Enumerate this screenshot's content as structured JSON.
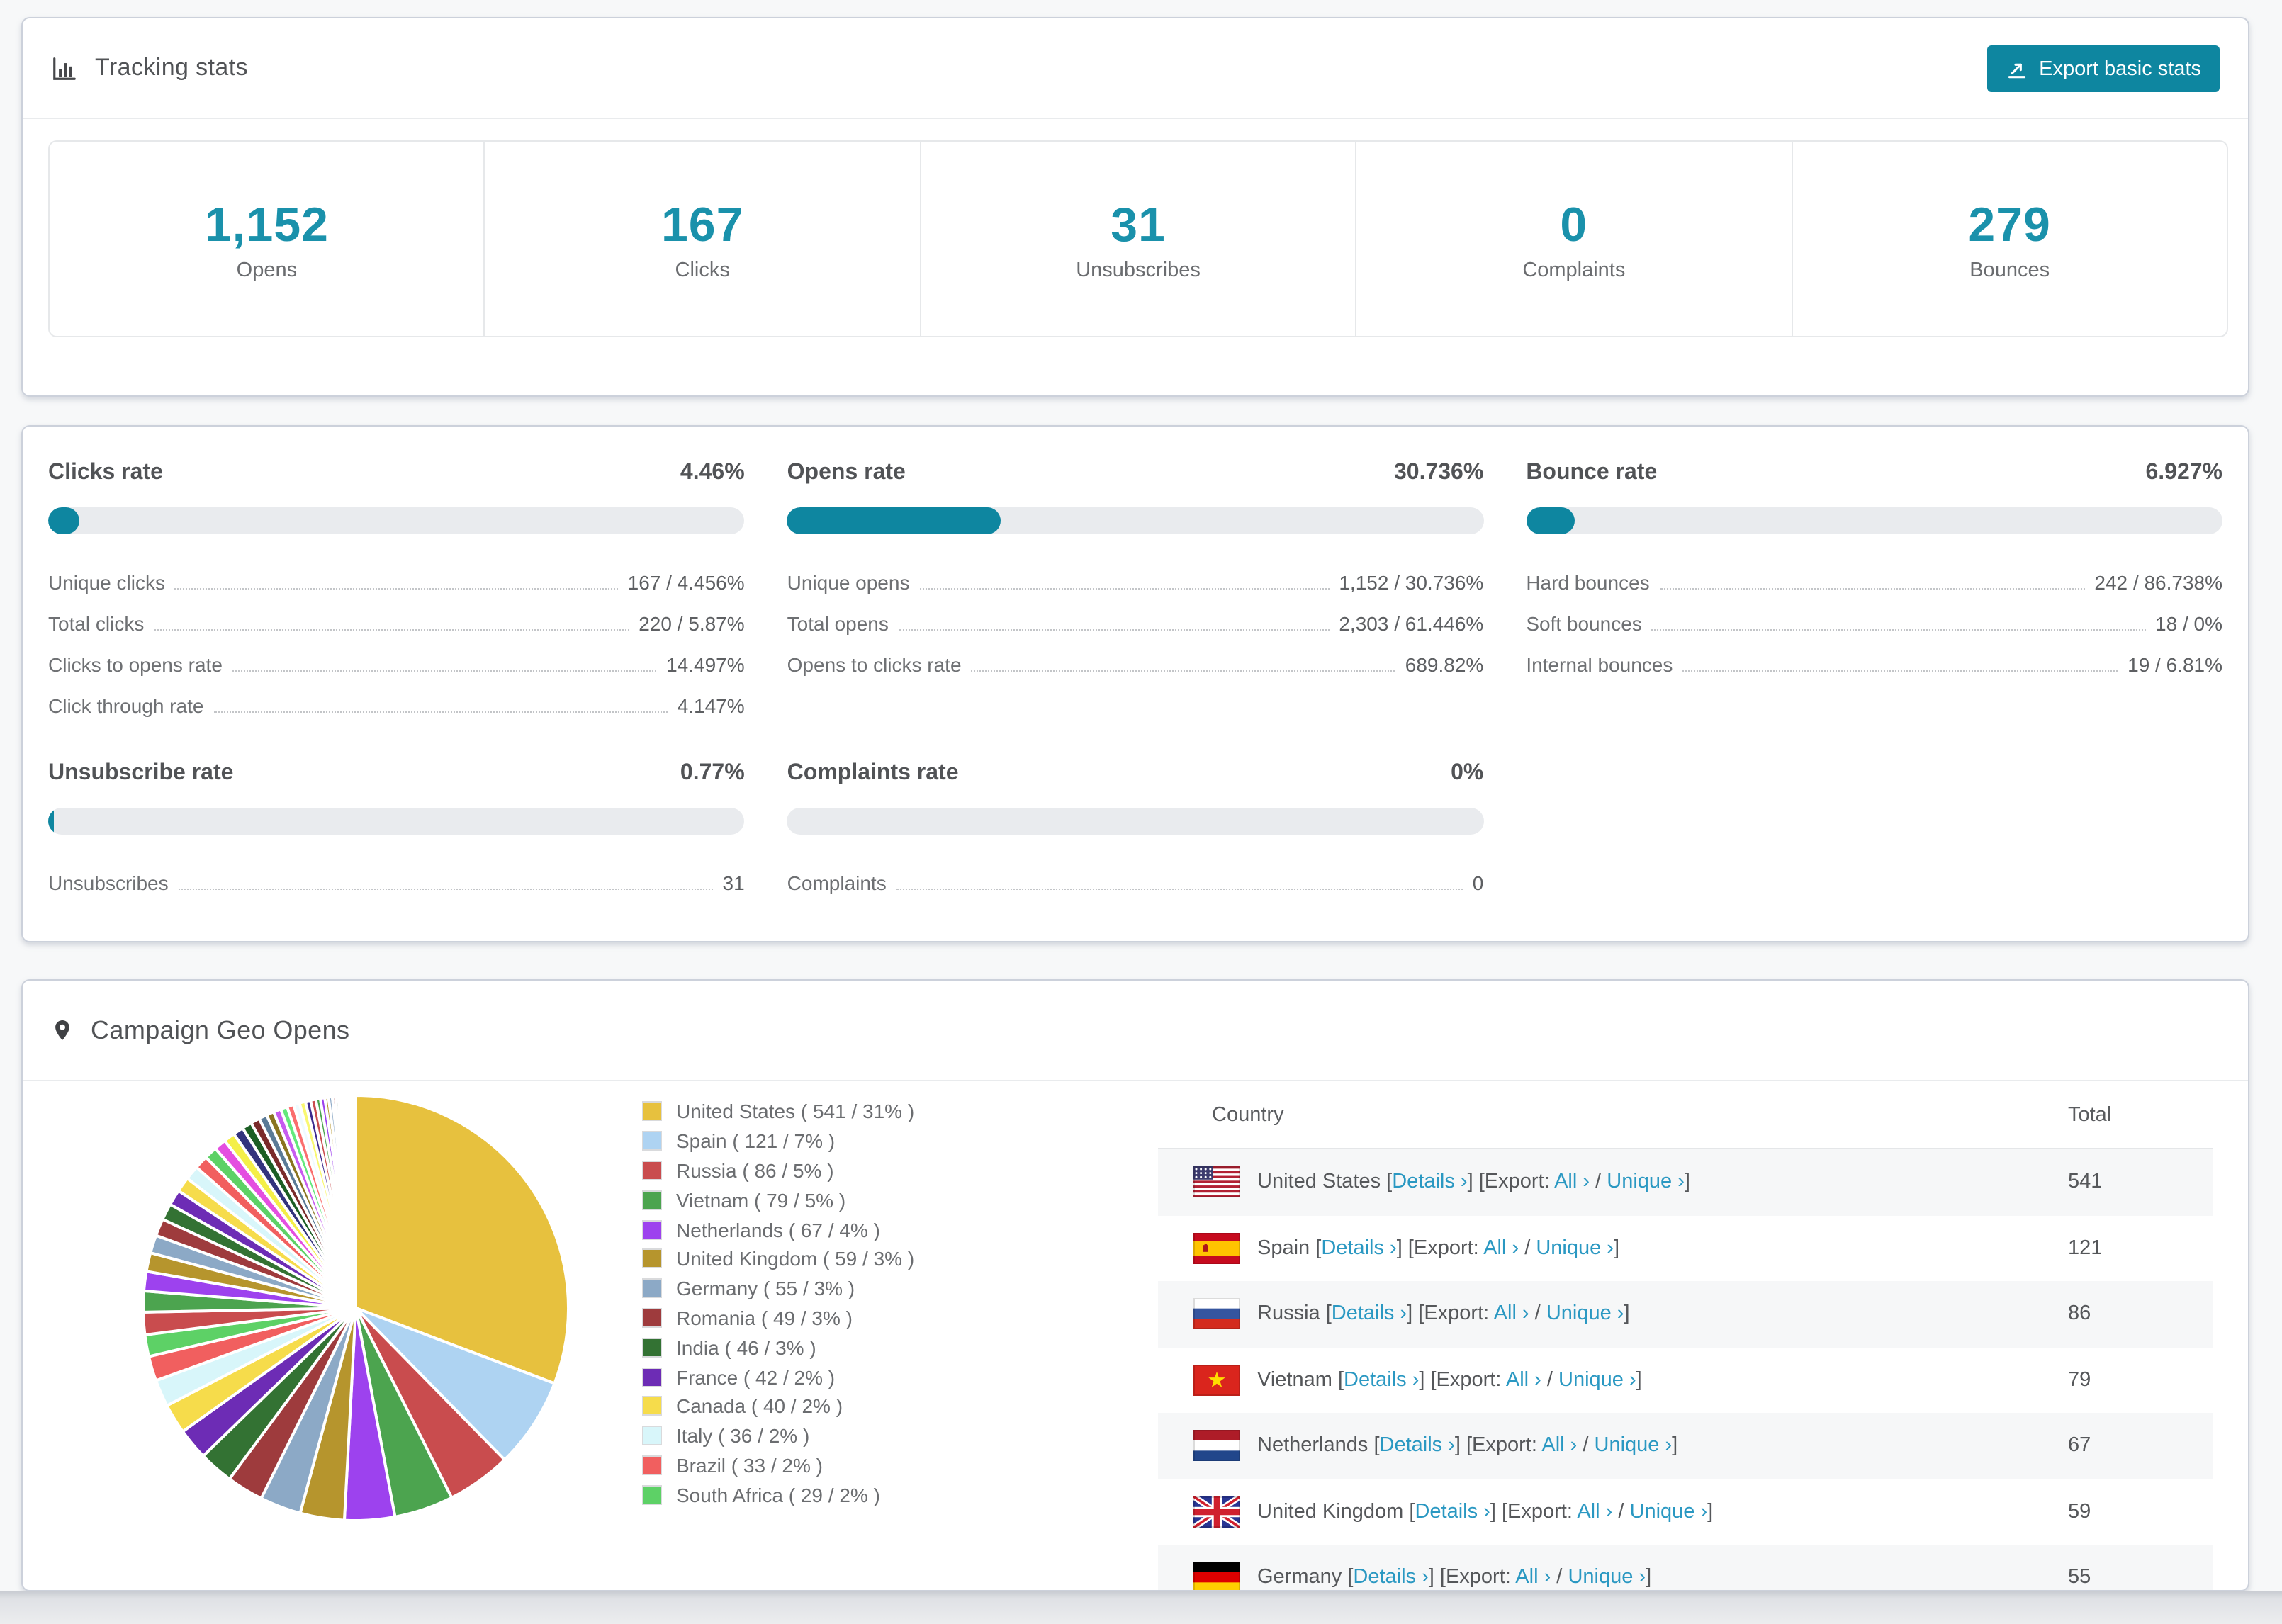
{
  "colors": {
    "accent_teal": "#0e86a0",
    "number_teal": "#1a91ab",
    "link_blue": "#2a98c2",
    "bar_track": "#e9ebee",
    "stripe": "#f6f7f8",
    "page_bg": "#f7f8f9"
  },
  "tracking": {
    "title": "Tracking stats",
    "export_button": "Export basic stats",
    "stats": [
      {
        "value": "1,152",
        "label": "Opens"
      },
      {
        "value": "167",
        "label": "Clicks"
      },
      {
        "value": "31",
        "label": "Unsubscribes"
      },
      {
        "value": "0",
        "label": "Complaints"
      },
      {
        "value": "279",
        "label": "Bounces"
      }
    ]
  },
  "rates": {
    "panels": [
      {
        "title": "Clicks rate",
        "percent_label": "4.46%",
        "percent": 4.46,
        "rows": [
          {
            "label": "Unique clicks",
            "value": "167 / 4.456%"
          },
          {
            "label": "Total clicks",
            "value": "220 / 5.87%"
          },
          {
            "label": "Clicks to opens rate",
            "value": "14.497%"
          },
          {
            "label": "Click through rate",
            "value": "4.147%"
          }
        ]
      },
      {
        "title": "Opens rate",
        "percent_label": "30.736%",
        "percent": 30.736,
        "rows": [
          {
            "label": "Unique opens",
            "value": "1,152 / 30.736%"
          },
          {
            "label": "Total opens",
            "value": "2,303 / 61.446%"
          },
          {
            "label": "Opens to clicks rate",
            "value": "689.82%"
          }
        ]
      },
      {
        "title": "Bounce rate",
        "percent_label": "6.927%",
        "percent": 6.927,
        "rows": [
          {
            "label": "Hard bounces",
            "value": "242 / 86.738%"
          },
          {
            "label": "Soft bounces",
            "value": "18 / 0%"
          },
          {
            "label": "Internal bounces",
            "value": "19 / 6.81%"
          }
        ]
      },
      {
        "title": "Unsubscribe rate",
        "percent_label": "0.77%",
        "percent": 0.77,
        "rows": [
          {
            "label": "Unsubscribes",
            "value": "31"
          }
        ]
      },
      {
        "title": "Complaints rate",
        "percent_label": "0%",
        "percent": 0,
        "rows": [
          {
            "label": "Complaints",
            "value": "0"
          }
        ]
      }
    ]
  },
  "geo": {
    "title": "Campaign Geo Opens",
    "col_country": "Country",
    "col_total": "Total",
    "link_details": "Details ›",
    "link_all": "All ›",
    "link_unique": "Unique ›",
    "t_open": "[",
    "t_close": "]",
    "t_export": "Export:",
    "t_slash": "/",
    "rows": [
      {
        "country": "United States",
        "flag": "us",
        "total": "541"
      },
      {
        "country": "Spain",
        "flag": "es",
        "total": "121"
      },
      {
        "country": "Russia",
        "flag": "ru",
        "total": "86"
      },
      {
        "country": "Vietnam",
        "flag": "vn",
        "total": "79"
      },
      {
        "country": "Netherlands",
        "flag": "nl",
        "total": "67"
      },
      {
        "country": "United Kingdom",
        "flag": "gb",
        "total": "59"
      },
      {
        "country": "Germany",
        "flag": "de",
        "total": "55"
      }
    ]
  },
  "chart_data": {
    "type": "pie",
    "title": "Campaign Geo Opens",
    "legend_position": "right",
    "start_angle_deg": -90,
    "direction": "clockwise",
    "slices": [
      {
        "label": "United States",
        "value": 541,
        "pct": "31%",
        "color": "#e7c13e"
      },
      {
        "label": "Spain",
        "value": 121,
        "pct": "7%",
        "color": "#aed3f2"
      },
      {
        "label": "Russia",
        "value": 86,
        "pct": "5%",
        "color": "#c94c4e"
      },
      {
        "label": "Vietnam",
        "value": 79,
        "pct": "5%",
        "color": "#4ca44f"
      },
      {
        "label": "Netherlands",
        "value": 67,
        "pct": "4%",
        "color": "#9d42ee"
      },
      {
        "label": "United Kingdom",
        "value": 59,
        "pct": "3%",
        "color": "#b6952d"
      },
      {
        "label": "Germany",
        "value": 55,
        "pct": "3%",
        "color": "#8ca9c6"
      },
      {
        "label": "Romania",
        "value": 49,
        "pct": "3%",
        "color": "#9e3b3d"
      },
      {
        "label": "India",
        "value": 46,
        "pct": "3%",
        "color": "#337233"
      },
      {
        "label": "France",
        "value": 42,
        "pct": "2%",
        "color": "#6d2cb5"
      },
      {
        "label": "Canada",
        "value": 40,
        "pct": "2%",
        "color": "#f6dc4b"
      },
      {
        "label": "Italy",
        "value": 36,
        "pct": "2%",
        "color": "#d8f6fa"
      },
      {
        "label": "Brazil",
        "value": 33,
        "pct": "2%",
        "color": "#f15f5f"
      },
      {
        "label": "South Africa",
        "value": 29,
        "pct": "2%",
        "color": "#5dd166"
      }
    ],
    "other_values": [
      30,
      28,
      26,
      25,
      24,
      23,
      22,
      21,
      20,
      19,
      18,
      17,
      16,
      15,
      14,
      13,
      12,
      11,
      10,
      10,
      9,
      9,
      8,
      8,
      7,
      7,
      6,
      6,
      5,
      5,
      4,
      4,
      3,
      3,
      3,
      2,
      2,
      2,
      2,
      1,
      1,
      1,
      1,
      1,
      1
    ],
    "tail_palette": [
      "#c94c4e",
      "#4ca44f",
      "#9d42ee",
      "#b6952d",
      "#8ca9c6",
      "#9e3b3d",
      "#337233",
      "#6d2cb5",
      "#f6dc4b",
      "#d8f6fa",
      "#f15f5f",
      "#5dd166",
      "#e44fe0",
      "#f4ef48",
      "#33337d",
      "#1c5e24",
      "#7a2b2b",
      "#5a7a96",
      "#8a7420",
      "#c75bf0",
      "#63e87c",
      "#fa6e6e",
      "#effbff",
      "#f9f871",
      "#3d2b8f"
    ]
  }
}
